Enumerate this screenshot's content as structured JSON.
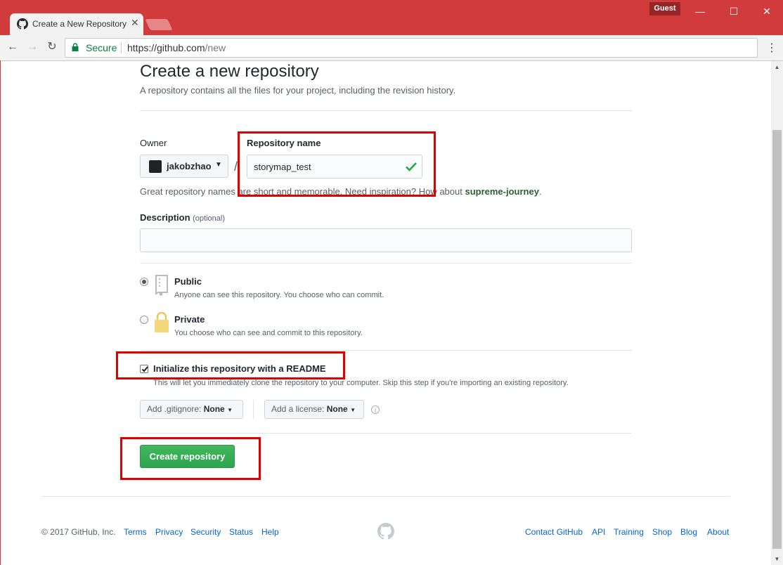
{
  "browser": {
    "tab_title": "Create a New Repository",
    "tab_close": "✕",
    "guest_label": "Guest",
    "window_controls": [
      "—",
      "☐",
      "✕"
    ],
    "secure_label": "Secure",
    "url_scheme_host": "https://github.com",
    "url_path": "/new",
    "accent_color": "#d23b3b"
  },
  "page": {
    "title": "Create a new repository",
    "subtitle": "A repository contains all the files for your project, including the revision history."
  },
  "form": {
    "owner_label": "Owner",
    "owner_name": "jakobzhao",
    "slash": "/",
    "repo_name_label": "Repository name",
    "repo_name_value": "storymap_test",
    "hint_prefix": "Great repository names are short and memorable. Need inspiration? How about ",
    "hint_suggestion": "supreme-journey",
    "hint_suffix": ".",
    "description_label": "Description",
    "description_optional": "(optional)",
    "description_value": "",
    "visibility": {
      "public_title": "Public",
      "public_desc": "Anyone can see this repository. You choose who can commit.",
      "private_title": "Private",
      "private_desc": "You choose who can see and commit to this repository.",
      "selected": "public"
    },
    "readme_label": "Initialize this repository with a README",
    "readme_checked": true,
    "readme_desc": "This will let you immediately clone the repository to your computer. Skip this step if you're importing an existing repository.",
    "gitignore_label": "Add .gitignore:",
    "gitignore_value": "None",
    "license_label": "Add a license:",
    "license_value": "None",
    "info_icon": "i",
    "create_button": "Create repository"
  },
  "footer": {
    "copyright": "© 2017 GitHub, Inc.",
    "left_links": [
      "Terms",
      "Privacy",
      "Security",
      "Status",
      "Help"
    ],
    "right_links": [
      "Contact GitHub",
      "API",
      "Training",
      "Shop",
      "Blog",
      "About"
    ]
  }
}
